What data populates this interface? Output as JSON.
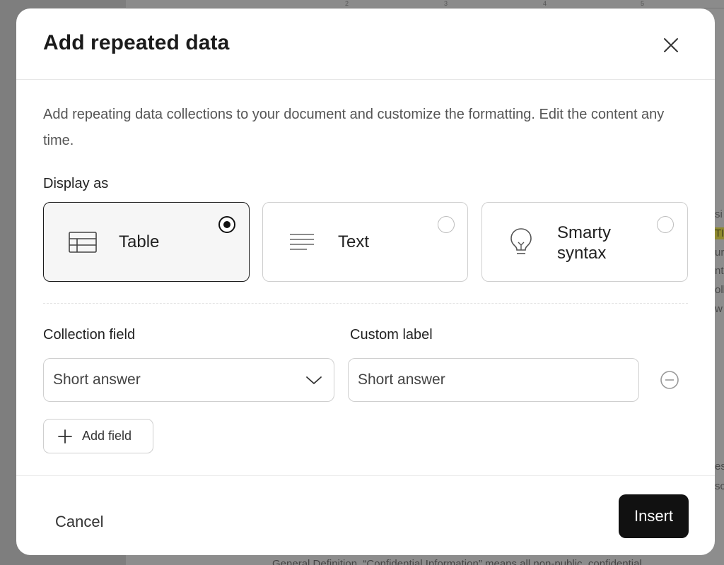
{
  "background": {
    "ruler_marks": [
      "2",
      "3",
      "4",
      "5"
    ],
    "fragments": [
      "si",
      "TI",
      "ur",
      "nt",
      "oll",
      "w",
      "es",
      "sc"
    ],
    "bottom_text": "General Definition. “Confidential Information” means all non-public, confidential"
  },
  "modal": {
    "title": "Add repeated data",
    "close_icon": "close-icon",
    "description": "Add repeating data collections to your document and customize the formatting. Edit the content any time.",
    "display_as_label": "Display as",
    "options": [
      {
        "label": "Table",
        "icon": "table-icon",
        "selected": true
      },
      {
        "label": "Text",
        "icon": "text-lines-icon",
        "selected": false
      },
      {
        "label": "Smarty syntax",
        "icon": "lightbulb-icon",
        "selected": false
      }
    ],
    "collection_field_label": "Collection field",
    "custom_label_label": "Custom label",
    "collection_field_value": "Short answer",
    "custom_label_value": "Short answer",
    "add_field_label": "Add field",
    "cancel_label": "Cancel",
    "insert_label": "Insert"
  }
}
